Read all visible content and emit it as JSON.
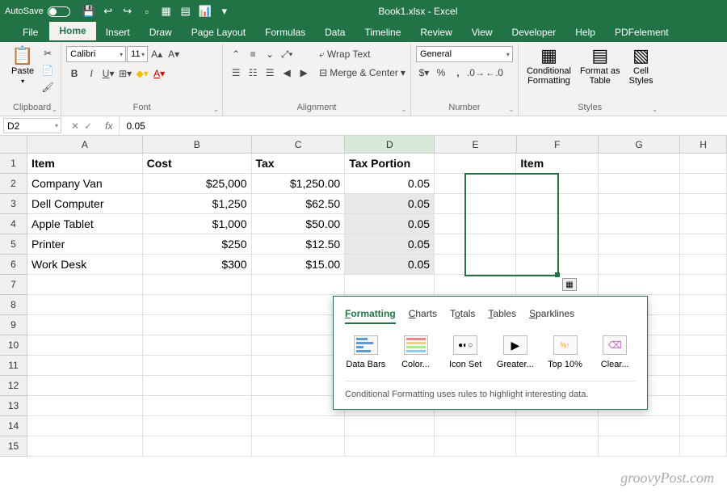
{
  "title": "Book1.xlsx - Excel",
  "autosave": "AutoSave",
  "tabs": [
    "File",
    "Home",
    "Insert",
    "Draw",
    "Page Layout",
    "Formulas",
    "Data",
    "Timeline",
    "Review",
    "View",
    "Developer",
    "Help",
    "PDFelement"
  ],
  "active_tab": "Home",
  "ribbon": {
    "clipboard": {
      "label": "Clipboard",
      "paste": "Paste"
    },
    "font": {
      "label": "Font",
      "name": "Calibri",
      "size": "11"
    },
    "alignment": {
      "label": "Alignment",
      "wrap": "Wrap Text",
      "merge": "Merge & Center"
    },
    "number": {
      "label": "Number",
      "format": "General"
    },
    "styles": {
      "label": "Styles",
      "cond": "Conditional\nFormatting",
      "table": "Format as\nTable",
      "cell": "Cell\nStyles"
    }
  },
  "formula": {
    "ref": "D2",
    "value": "0.05"
  },
  "cols": [
    "A",
    "B",
    "C",
    "D",
    "E",
    "F",
    "G",
    "H"
  ],
  "rows": [
    "1",
    "2",
    "3",
    "4",
    "5",
    "6",
    "7",
    "8",
    "9",
    "10",
    "11",
    "12",
    "13",
    "14",
    "15"
  ],
  "headers": {
    "A": "Item",
    "B": "Cost",
    "C": "Tax",
    "D": "Tax Portion",
    "F": "Item"
  },
  "data": [
    {
      "A": "Company Van",
      "B": "$25,000",
      "C": "$1,250.00",
      "D": "0.05"
    },
    {
      "A": "Dell Computer",
      "B": "$1,250",
      "C": "$62.50",
      "D": "0.05"
    },
    {
      "A": "Apple Tablet",
      "B": "$1,000",
      "C": "$50.00",
      "D": "0.05"
    },
    {
      "A": "Printer",
      "B": "$250",
      "C": "$12.50",
      "D": "0.05"
    },
    {
      "A": "Work Desk",
      "B": "$300",
      "C": "$15.00",
      "D": "0.05"
    }
  ],
  "qa": {
    "tabs": [
      "Formatting",
      "Charts",
      "Totals",
      "Tables",
      "Sparklines"
    ],
    "items": [
      "Data Bars",
      "Color...",
      "Icon Set",
      "Greater...",
      "Top 10%",
      "Clear..."
    ],
    "desc": "Conditional Formatting uses rules to highlight interesting data."
  },
  "watermark": "groovyPost.com"
}
